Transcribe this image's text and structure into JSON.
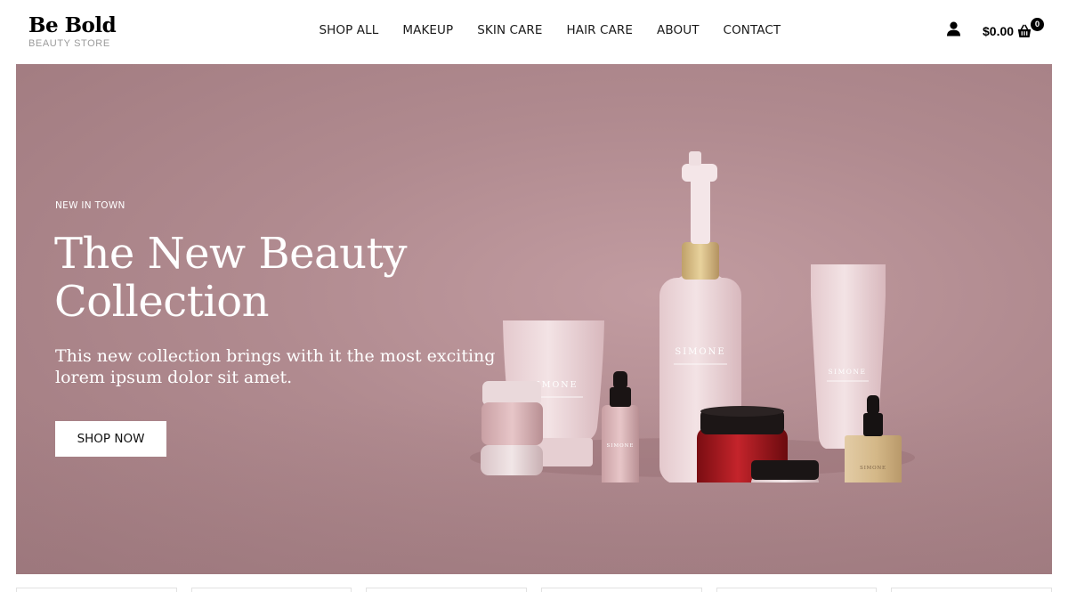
{
  "brand": {
    "name": "Be Bold",
    "tagline": "BEAUTY STORE"
  },
  "nav": {
    "items": [
      {
        "label": "SHOP ALL"
      },
      {
        "label": "MAKEUP"
      },
      {
        "label": "SKIN CARE"
      },
      {
        "label": "HAIR CARE"
      },
      {
        "label": "ABOUT"
      },
      {
        "label": "CONTACT"
      }
    ]
  },
  "header_actions": {
    "account_icon": "user-icon",
    "cart_total": "$0.00",
    "cart_icon": "shopping-basket-icon",
    "cart_count": "0"
  },
  "hero": {
    "eyebrow": "NEW IN TOWN",
    "title": "The New Beauty Collection",
    "text": "This new collection brings with it the most exciting lorem ipsum dolor sit amet.",
    "button_label": "SHOP NOW",
    "product_brand": "SIMONE",
    "background_color": "#b08a8f"
  }
}
